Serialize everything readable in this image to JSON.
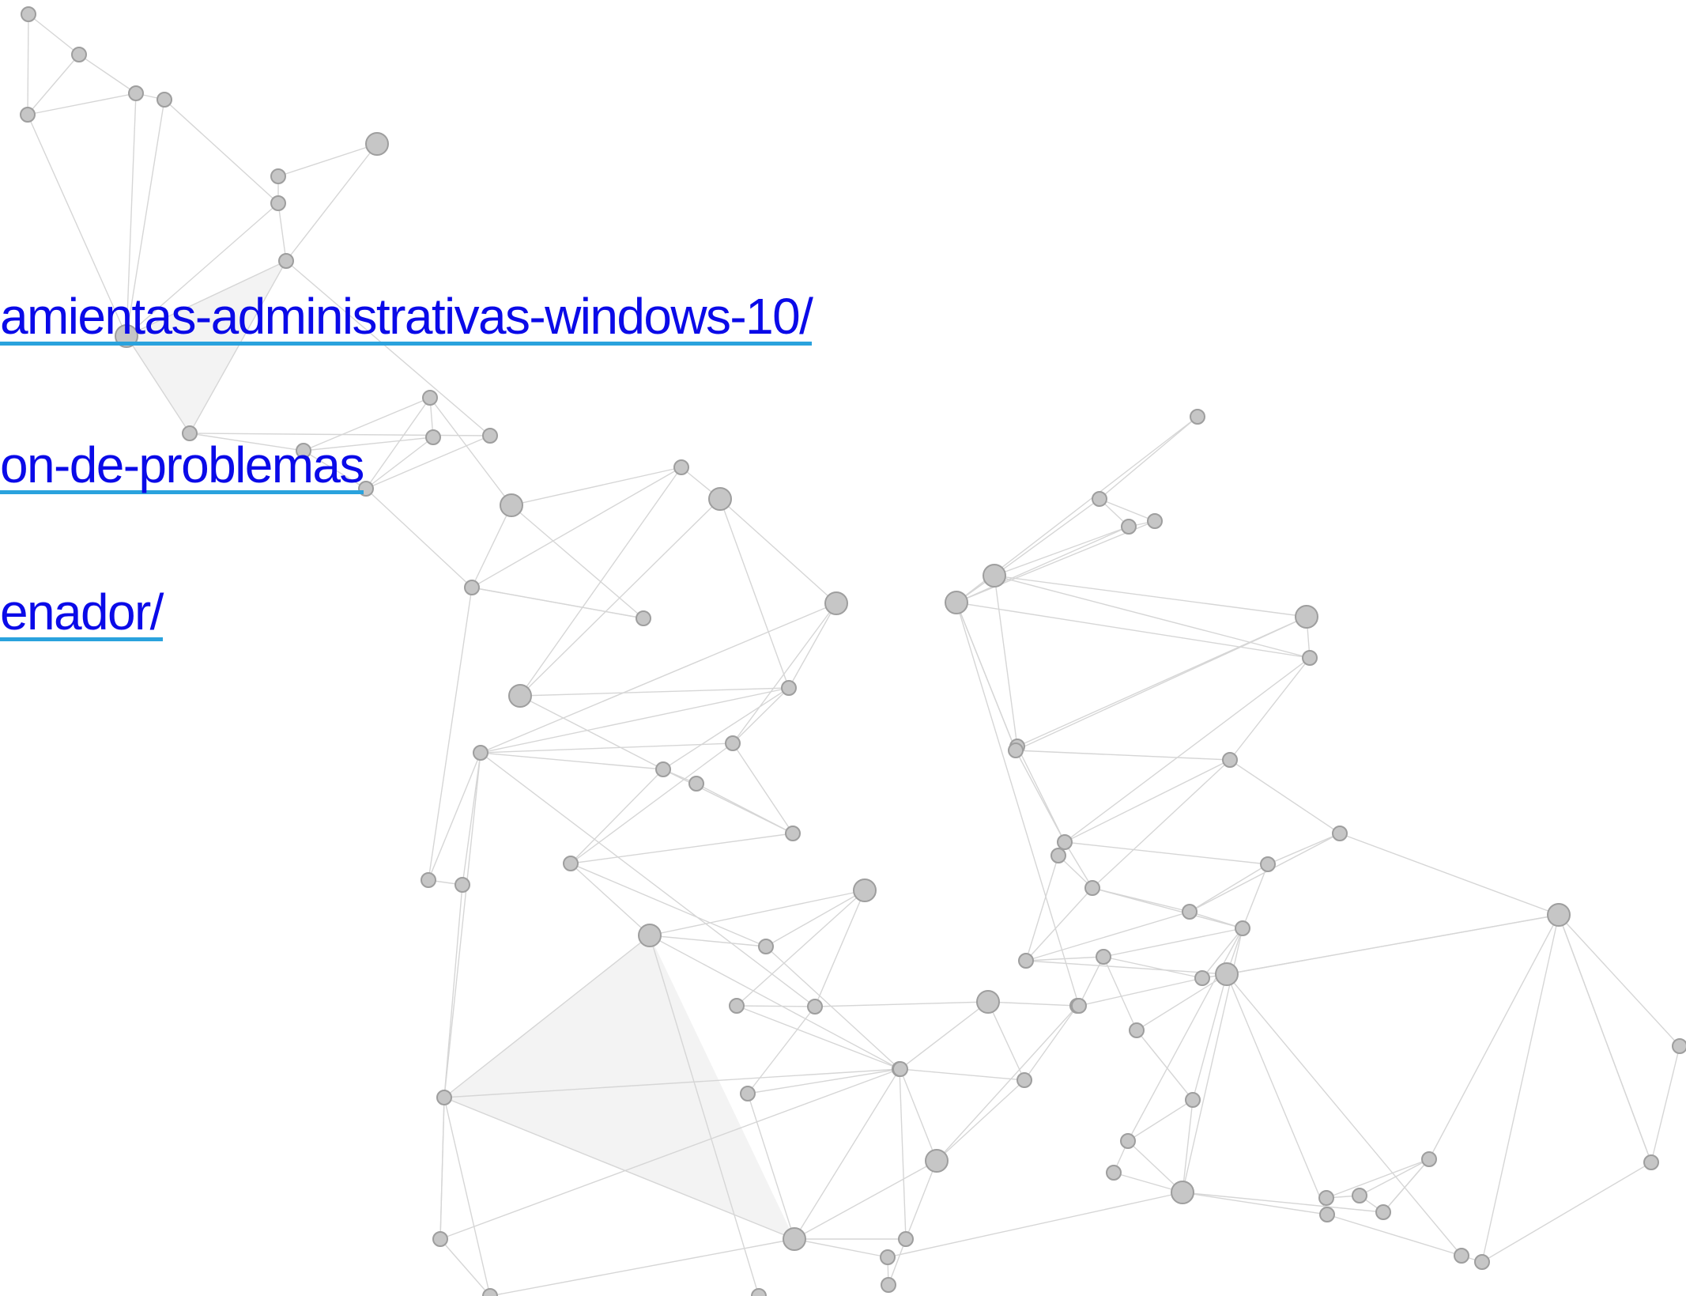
{
  "links": [
    {
      "text": "amientas-administrativas-windows-10/"
    },
    {
      "text": "on-de-problemas"
    },
    {
      "text": "enador/"
    }
  ],
  "colors": {
    "link_text": "#0a0ae8",
    "link_underline": "#2aa2dd",
    "node_fill": "#c6c6c6",
    "node_stroke": "#9e9e9e",
    "edge": "#d6d6d6",
    "background": "#ffffff"
  }
}
